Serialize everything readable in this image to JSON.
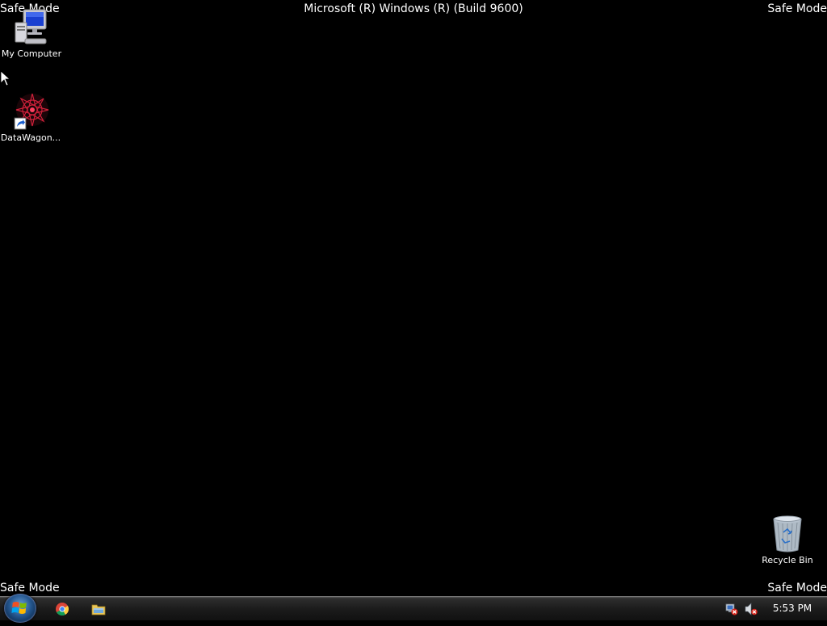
{
  "overlay": {
    "safe_mode_top_left": "Safe Mode",
    "safe_mode_top_right": "Safe Mode",
    "safe_mode_bottom_left": "Safe Mode",
    "safe_mode_bottom_right": "Safe Mode",
    "os_title": "Microsoft (R) Windows (R) (Build 9600)"
  },
  "desktop": {
    "background_color": "#000000",
    "icons": [
      {
        "label": "My Computer",
        "icon": "computer-icon"
      },
      {
        "label": "DataWagon...",
        "icon": "datawagon-shortcut-icon"
      },
      {
        "label": "Recycle Bin",
        "icon": "recycle-bin-icon"
      }
    ]
  },
  "taskbar": {
    "start_icon": "windows-orb-icon",
    "quick_launch": [
      {
        "icon": "chrome-icon"
      },
      {
        "icon": "file-explorer-icon"
      }
    ],
    "tray": {
      "icons": [
        "network-disconnected-icon",
        "volume-muted-icon"
      ],
      "clock": "5:53 PM"
    }
  }
}
